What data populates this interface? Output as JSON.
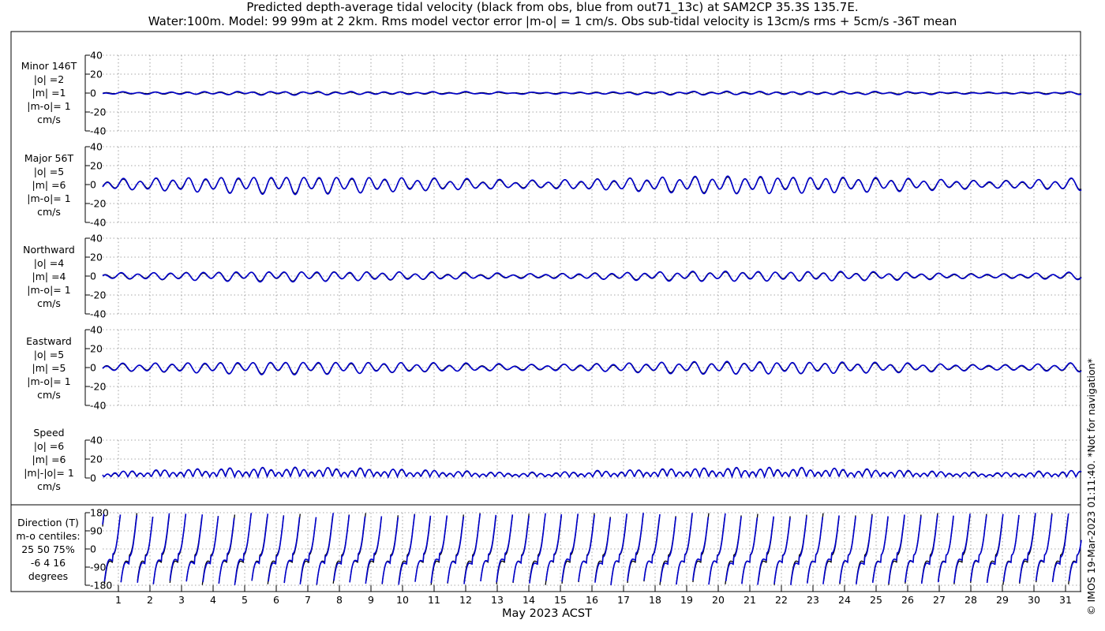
{
  "title_line1": "Predicted depth-average tidal velocity (black from obs, blue from out71_13c) at SAM2CP 35.3S 135.7E.",
  "title_line2": "Water:100m. Model: 99 99m at 2 2km. Rms model vector error |m-o| = 1 cm/s. Obs sub-tidal velocity is 13cm/s rms + 5cm/s -36T mean",
  "xlabel": "May 2023 ACST",
  "footer": "© IMOS 19-Mar-2023 01:11:40. *Not for navigation*",
  "colors": {
    "obs": "#000000",
    "model": "#0000cc",
    "grid": "#8a8a8a"
  },
  "panels": [
    {
      "label_lines": [
        "Minor 146T",
        "|o| =2",
        "|m| =1",
        "|m-o|= 1",
        "cm/s"
      ]
    },
    {
      "label_lines": [
        "Major 56T",
        "|o| =5",
        "|m| =6",
        "|m-o|= 1",
        "cm/s"
      ]
    },
    {
      "label_lines": [
        "Northward",
        "|o| =4",
        "|m| =4",
        "|m-o|= 1",
        "cm/s"
      ]
    },
    {
      "label_lines": [
        "Eastward",
        "|o| =5",
        "|m| =5",
        "|m-o|= 1",
        "cm/s"
      ]
    },
    {
      "label_lines": [
        "Speed",
        "|o| =6",
        "|m| =6",
        "|m|-|o|= 1",
        "cm/s"
      ]
    },
    {
      "label_lines": [
        "Direction (T)",
        "m-o centiles:",
        "25  50  75%",
        "-6   4  16",
        "degrees"
      ]
    }
  ],
  "chart_data": [
    {
      "type": "line",
      "panel": "Minor 146T",
      "ylim": [
        -40,
        40
      ],
      "yticks": [
        -40,
        -20,
        0,
        20,
        40
      ],
      "x_range": [
        0.5,
        31.5
      ],
      "x_ticks": [
        1,
        2,
        3,
        4,
        5,
        6,
        7,
        8,
        9,
        10,
        11,
        12,
        13,
        14,
        15,
        16,
        17,
        18,
        19,
        20,
        21,
        22,
        23,
        24,
        25,
        26,
        27,
        28,
        29,
        30,
        31
      ],
      "grid": true,
      "rms_obs": 2,
      "rms_model": 1,
      "rms_error": 1
    },
    {
      "type": "line",
      "panel": "Major 56T",
      "ylim": [
        -40,
        40
      ],
      "yticks": [
        -40,
        -20,
        0,
        20,
        40
      ],
      "x_range": [
        0.5,
        31.5
      ],
      "grid": true,
      "rms_obs": 5,
      "rms_model": 6,
      "rms_error": 1
    },
    {
      "type": "line",
      "panel": "Northward",
      "ylim": [
        -40,
        40
      ],
      "yticks": [
        -40,
        -20,
        0,
        20,
        40
      ],
      "x_range": [
        0.5,
        31.5
      ],
      "grid": true,
      "rms_obs": 4,
      "rms_model": 4,
      "rms_error": 1
    },
    {
      "type": "line",
      "panel": "Eastward",
      "ylim": [
        -40,
        40
      ],
      "yticks": [
        -40,
        -20,
        0,
        20,
        40
      ],
      "x_range": [
        0.5,
        31.5
      ],
      "grid": true,
      "rms_obs": 5,
      "rms_model": 5,
      "rms_error": 1
    },
    {
      "type": "line",
      "panel": "Speed",
      "ylim": [
        0,
        40
      ],
      "yticks": [
        0,
        20,
        40
      ],
      "x_range": [
        0.5,
        31.5
      ],
      "grid": true,
      "rms_obs": 6,
      "rms_model": 6,
      "rms_error": 1
    },
    {
      "type": "line",
      "panel": "Direction (T)",
      "ylim": [
        -180,
        180
      ],
      "yticks": [
        -180,
        -90,
        0,
        90,
        180
      ],
      "x_range": [
        0.5,
        31.5
      ],
      "grid": true,
      "centiles": [
        -6,
        4,
        16
      ]
    }
  ]
}
